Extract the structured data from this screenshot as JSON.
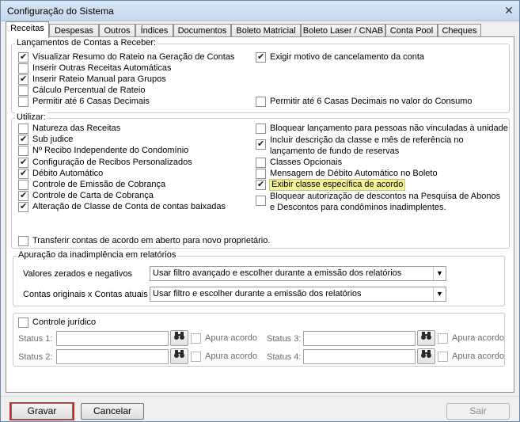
{
  "window": {
    "title": "Configuração do Sistema"
  },
  "tabs": [
    "Receitas",
    "Despesas",
    "Outros",
    "Índices",
    "Documentos",
    "Boleto Matricial",
    "Boleto Laser / CNAB",
    "Conta Pool",
    "Cheques"
  ],
  "lancamentos": {
    "legend": "Lançamentos de Contas a Receber:",
    "left": [
      {
        "label": "Visualizar Resumo do Rateio na Geração de Contas",
        "checked": true
      },
      {
        "label": "Inserir Outras Receitas Automáticas",
        "checked": false
      },
      {
        "label": "Inserir Rateio Manual para Grupos",
        "checked": true
      },
      {
        "label": "Cálculo Percentual de Rateio",
        "checked": false
      },
      {
        "label": "Permitir até 6 Casas Decimais",
        "checked": false
      }
    ],
    "right": [
      {
        "label": "Exigir motivo de cancelamento da conta",
        "checked": true
      },
      {
        "label": "Permitir até 6 Casas Decimais no valor do Consumo",
        "checked": false
      }
    ]
  },
  "utilizar": {
    "legend": "Utilizar:",
    "left": [
      {
        "label": "Natureza das Receitas",
        "checked": false
      },
      {
        "label": "Sub judice",
        "checked": true
      },
      {
        "label": "Nº Recibo Independente do Condomínio",
        "checked": false
      },
      {
        "label": "Configuração de Recibos Personalizados",
        "checked": true
      },
      {
        "label": "Débito Automático",
        "checked": true
      },
      {
        "label": "Controle de Emissão de Cobrança",
        "checked": false
      },
      {
        "label": "Controle de Carta de Cobrança",
        "checked": true
      },
      {
        "label": "Alteração de Classe de Conta de contas baixadas",
        "checked": true
      }
    ],
    "right": [
      {
        "label": "Bloquear lançamento para pessoas não vinculadas à unidade",
        "checked": false
      },
      {
        "label": "Incluir descrição da classe e mês de referência no lançamento de fundo de reservas",
        "checked": true
      },
      {
        "label": "Classes Opcionais",
        "checked": false
      },
      {
        "label": "Mensagem de Débito Automático no Boleto",
        "checked": false
      },
      {
        "label": "Exibir classe específica de acordo",
        "checked": true
      },
      {
        "label": "Bloquear autorização de descontos na Pesquisa de Abonos e Descontos para condôminos inadimplentes.",
        "checked": false
      }
    ],
    "transferir": {
      "label": "Transferir contas de acordo em aberto para novo proprietário.",
      "checked": false
    }
  },
  "apuracao": {
    "legend": "Apuração da inadimplência em relatórios",
    "valores_label": "Valores zerados e negativos",
    "valores_value": "Usar filtro avançado e escolher durante a emissão dos relatórios",
    "contas_label": "Contas originais x Contas atuais",
    "contas_value": "Usar filtro e escolher durante a emissão dos relatórios"
  },
  "juridico": {
    "label": "Controle jurídico",
    "checked": false,
    "status": [
      {
        "label": "Status 1:",
        "apura": "Apura acordo"
      },
      {
        "label": "Status 2:",
        "apura": "Apura acordo"
      },
      {
        "label": "Status 3:",
        "apura": "Apura acordo"
      },
      {
        "label": "Status 4:",
        "apura": "Apura acordo"
      }
    ]
  },
  "buttons": {
    "gravar": "Gravar",
    "cancelar": "Cancelar",
    "sair": "Sair"
  },
  "colors": {
    "highlight": "#f4f39a",
    "focus": "#d12a2a"
  }
}
